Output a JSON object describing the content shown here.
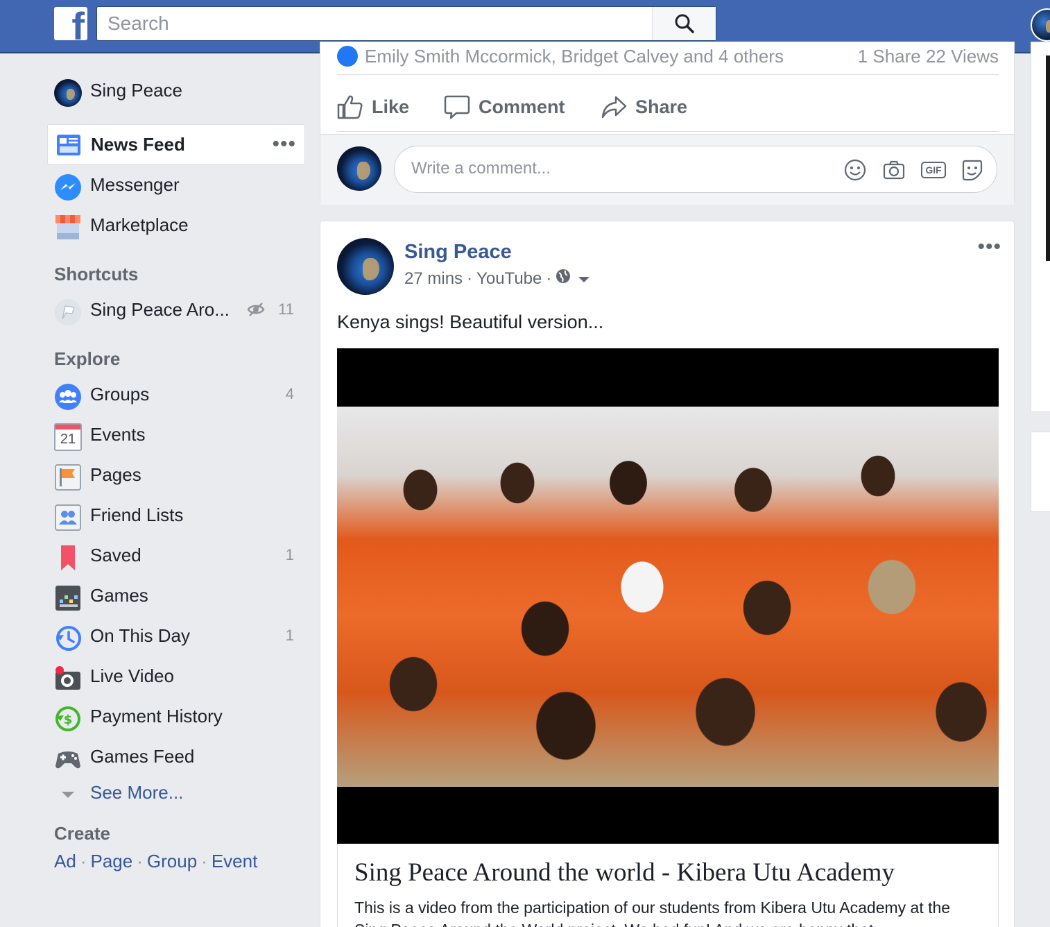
{
  "topbar": {
    "logo": "f",
    "search_placeholder": "Search",
    "brand_color": "#4267b2"
  },
  "sidebar": {
    "profile": {
      "label": "Sing Peace"
    },
    "news_feed": {
      "label": "News Feed",
      "menu": "•••"
    },
    "messenger": {
      "label": "Messenger"
    },
    "marketplace": {
      "label": "Marketplace"
    },
    "shortcuts_heading": "Shortcuts",
    "shortcuts": [
      {
        "label": "Sing Peace Aro...",
        "count": "11"
      }
    ],
    "explore_heading": "Explore",
    "explore": [
      {
        "label": "Groups",
        "count": "4",
        "icon": "groups-icon"
      },
      {
        "label": "Events",
        "count": "",
        "icon": "calendar-icon",
        "day": "21"
      },
      {
        "label": "Pages",
        "count": "",
        "icon": "flag-icon"
      },
      {
        "label": "Friend Lists",
        "count": "",
        "icon": "friend-list-icon"
      },
      {
        "label": "Saved",
        "count": "1",
        "icon": "bookmark-icon"
      },
      {
        "label": "Games",
        "count": "",
        "icon": "games-icon"
      },
      {
        "label": "On This Day",
        "count": "1",
        "icon": "history-icon"
      },
      {
        "label": "Live Video",
        "count": "",
        "icon": "live-video-icon"
      },
      {
        "label": "Payment History",
        "count": "",
        "icon": "payment-icon"
      },
      {
        "label": "Games Feed",
        "count": "",
        "icon": "gamepad-icon"
      }
    ],
    "see_more": "See More...",
    "create_heading": "Create",
    "create_links": [
      "Ad",
      "Page",
      "Group",
      "Event"
    ]
  },
  "prev_post": {
    "reactions_text": "Emily Smith Mccormick, Bridget Calvey and 4 others",
    "stats": "1 Share  22 Views",
    "actions": {
      "like": "Like",
      "comment": "Comment",
      "share": "Share"
    },
    "comment_placeholder": "Write a comment...",
    "gif_label": "GIF"
  },
  "post": {
    "author": "Sing Peace",
    "time": "27 mins",
    "source": "YouTube",
    "privacy_icon": "globe-icon",
    "menu": "•••",
    "text": "Kenya sings! Beautiful version...",
    "link_title": "Sing Peace Around the world - Kibera Utu Academy",
    "link_description": "This is a video from the participation of our students from Kibera Utu Academy at the Sing Peace Around the World project. We had fun! And we are happy that"
  }
}
